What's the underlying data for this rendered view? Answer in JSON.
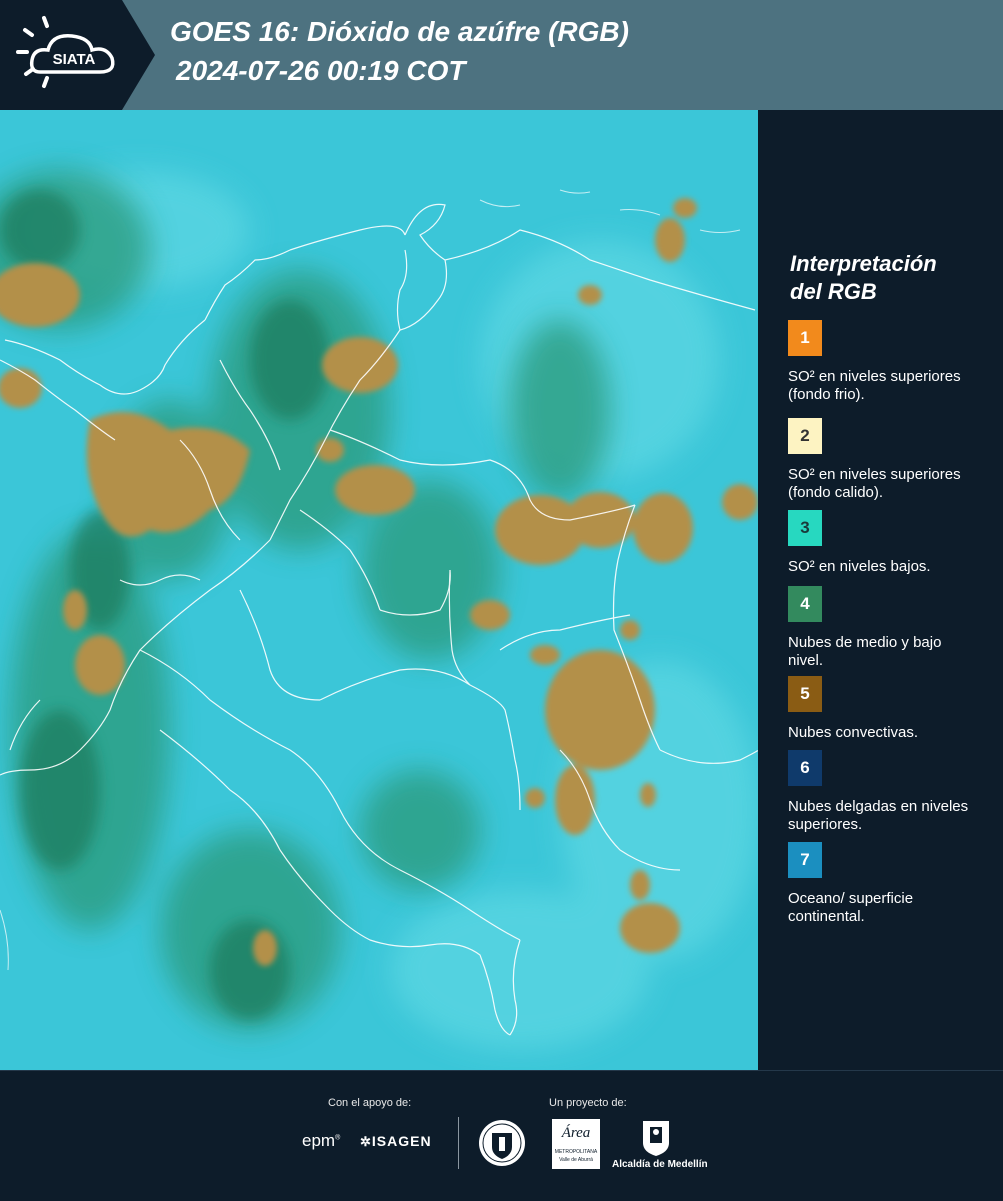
{
  "header": {
    "logo_text": "SIATA",
    "title_line1": "GOES 16: Dióxido de azúfre (RGB)",
    "title_line2": "2024-07-26 00:19 COT"
  },
  "map": {
    "description_icon": "satellite-rgb-imagery"
  },
  "legend": {
    "title_line1": "Interpretación",
    "title_line2": "del RGB",
    "items": [
      {
        "num": "1",
        "label": "SO² en niveles superiores (fondo frio).",
        "color": "#f28a1c",
        "text_color": "#ffffff"
      },
      {
        "num": "2",
        "label": "SO² en niveles superiores (fondo calido).",
        "color": "#fdf3c2",
        "text_color": "#333333"
      },
      {
        "num": "3",
        "label": "SO² en niveles bajos.",
        "color": "#27d8c0",
        "text_color": "#1a3a3a"
      },
      {
        "num": "4",
        "label": "Nubes de medio y bajo nivel.",
        "color": "#338a5e",
        "text_color": "#ffffff"
      },
      {
        "num": "5",
        "label": "Nubes convectivas.",
        "color": "#8a5c14",
        "text_color": "#ffffff"
      },
      {
        "num": "6",
        "label": "Nubes delgadas en niveles superiores.",
        "color": "#0f3a6b",
        "text_color": "#ffffff"
      },
      {
        "num": "7",
        "label": "Oceano/ superficie continental.",
        "color": "#1b8fc0",
        "text_color": "#ffffff"
      }
    ]
  },
  "footer": {
    "support_label": "Con el apoyo de:",
    "project_label": "Un proyecto de:",
    "sponsor_epm": "epm",
    "sponsor_isagen": "ISAGEN",
    "partner_alcaldia": "Alcaldía de Medellín",
    "partner_area": "Área",
    "partner_area_sub": "METROPOLITANA",
    "partner_area_sub2": "Valle de Aburrá"
  }
}
